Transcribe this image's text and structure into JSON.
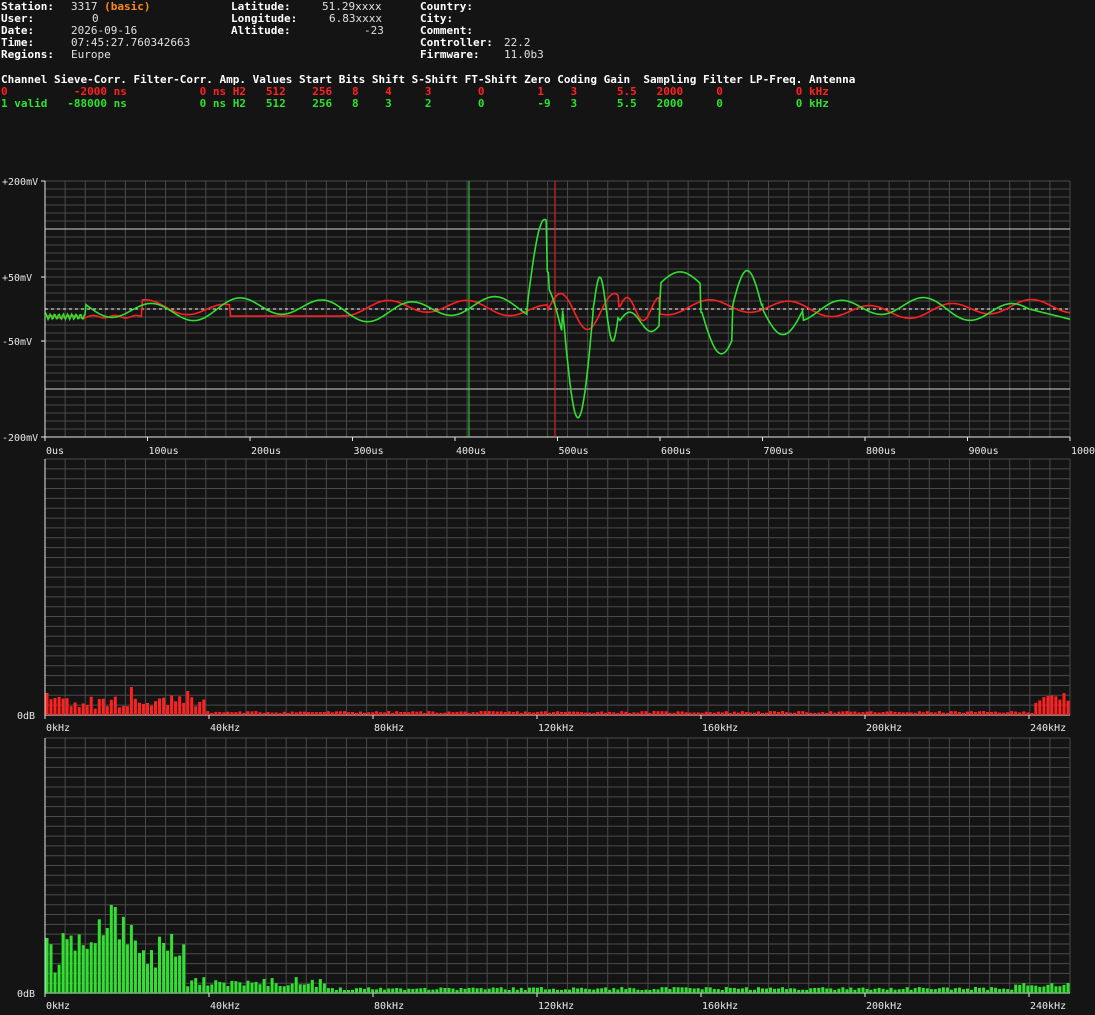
{
  "info": {
    "col1": [
      {
        "label": "Station:",
        "value": "3317",
        "extra": "(basic)"
      },
      {
        "label": "User:",
        "value": "0"
      },
      {
        "label": "Date:",
        "value": "2026-09-16"
      },
      {
        "label": "Time:",
        "value": "07:45:27.760342663"
      },
      {
        "label": "Regions:",
        "value": "Europe"
      }
    ],
    "col2": [
      {
        "label": "Latitude:",
        "value": "51.29xxxx"
      },
      {
        "label": "Longitude:",
        "value": "6.83xxxx"
      },
      {
        "label": "Altitude:",
        "value": "-23"
      }
    ],
    "col3": [
      {
        "label": "Country:",
        "value": ""
      },
      {
        "label": "City:",
        "value": ""
      },
      {
        "label": "Comment:",
        "value": ""
      },
      {
        "label": "Controller:",
        "value": "22.2"
      },
      {
        "label": "Firmware:",
        "value": "11.0b3"
      }
    ]
  },
  "channels": {
    "header": "Channel Sieve-Corr. Filter-Corr. Amp. Values Start Bits Shift S-Shift FT-Shift Zero Coding Gain  Sampling Filter LP-Freq. Antenna",
    "rows": [
      "0          -2000 ns           0 ns H2   512    256   8    4     3       0        1    3      5.5   2000     0           0 kHz",
      "1 valid   -88000 ns           0 ns H2   512    256   8    3     2       0        -9   3      5.5   2000     0           0 kHz"
    ]
  },
  "colors": {
    "ch0": "#ff2020",
    "ch1": "#30e030",
    "grid": "#4a4a4a",
    "axis": "#e8e8e8",
    "bg": "#141414"
  },
  "waveform": {
    "y_ticks": [
      "+200mV",
      "+50mV",
      "-50mV",
      "-200mV"
    ],
    "x_ticks": [
      "0us",
      "100us",
      "200us",
      "300us",
      "400us",
      "500us",
      "600us",
      "700us",
      "800us",
      "900us",
      "1000us"
    ],
    "y_range": [
      -200,
      200
    ],
    "x_range": [
      0,
      1000
    ],
    "x_unit": "us",
    "y_unit": "mV"
  },
  "spectrum": {
    "x_ticks": [
      "0kHz",
      "40kHz",
      "80kHz",
      "120kHz",
      "160kHz",
      "200kHz",
      "240kHz"
    ],
    "y_label": "0dB",
    "x_range": [
      0,
      250
    ]
  }
}
